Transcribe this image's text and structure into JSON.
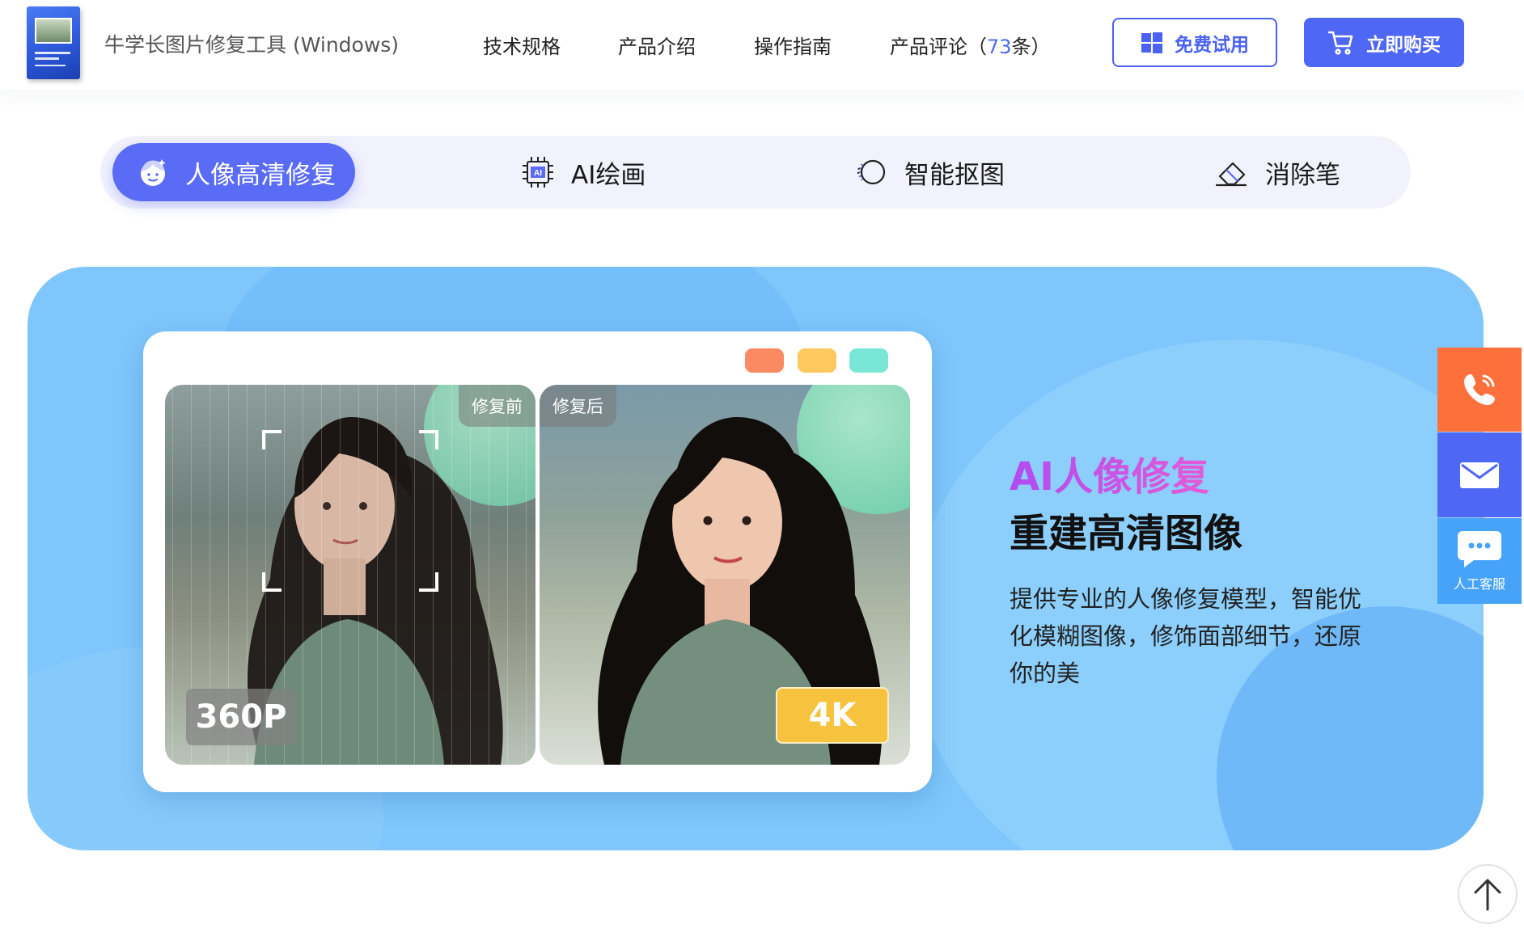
{
  "header": {
    "product_name": "牛学长图片修复工具 (Windows)",
    "nav": [
      {
        "label": "技术规格"
      },
      {
        "label": "产品介绍"
      },
      {
        "label": "操作指南"
      },
      {
        "label": "产品评论",
        "count_prefix": "（",
        "count": "73",
        "count_suffix": "条）"
      }
    ],
    "trial_label": "免费试用",
    "buy_label": "立即购买"
  },
  "tabs": [
    {
      "label": "人像高清修复",
      "icon": "face-icon",
      "active": true
    },
    {
      "label": "AI绘画",
      "icon": "ai-chip-icon",
      "active": false
    },
    {
      "label": "智能抠图",
      "icon": "cutout-circle-icon",
      "active": false
    },
    {
      "label": "消除笔",
      "icon": "eraser-icon",
      "active": false
    }
  ],
  "hero": {
    "title_accent": "AI人像修复",
    "title_main": "重建高清图像",
    "description": "提供专业的人像修复模型，智能优化模糊图像，修饰面部细节，还原你的美",
    "before_label": "修复前",
    "after_label": "修复后",
    "before_resolution": "360P",
    "after_resolution": "4K",
    "window_dot_colors": [
      "#fb8a62",
      "#fdc95e",
      "#79e6d6"
    ]
  },
  "side": {
    "chat_label": "人工客服"
  },
  "colors": {
    "brand": "#4f67f5",
    "hero_bg": "#7ec6fb",
    "phone": "#fd6f3b",
    "mail": "#4e67f4",
    "chat": "#46a3f8",
    "badge_4k": "#f7c23e"
  }
}
